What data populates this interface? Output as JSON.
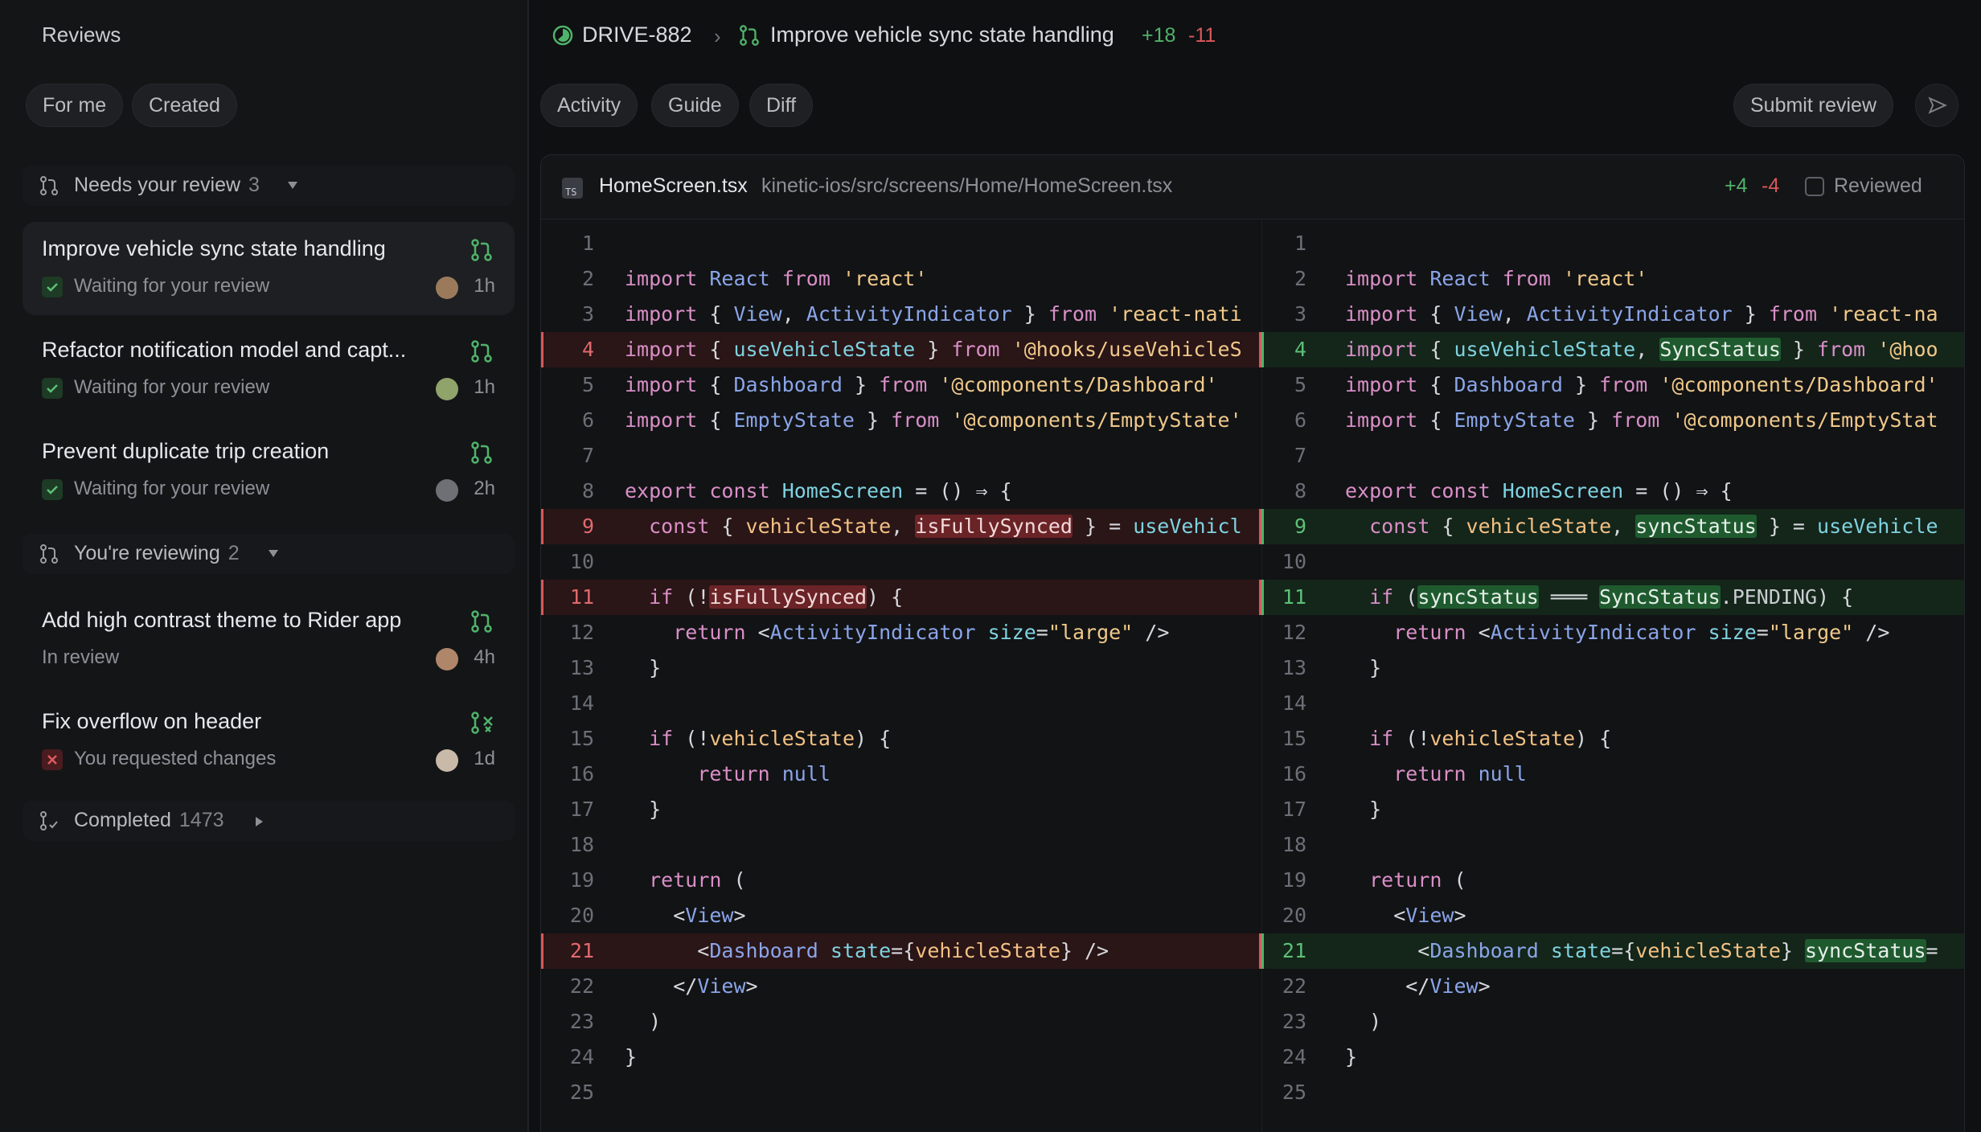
{
  "sidebar": {
    "title": "Reviews",
    "filters": [
      "For me",
      "Created"
    ],
    "sections": [
      {
        "label": "Needs your review",
        "count": "3"
      },
      {
        "label": "You're reviewing",
        "count": "2"
      },
      {
        "label": "Completed",
        "count": "1473"
      }
    ],
    "items": [
      {
        "title": "Improve vehicle sync state handling",
        "status": "Waiting for your review",
        "time": "1h"
      },
      {
        "title": "Refactor notification model and capt...",
        "status": "Waiting for your review",
        "time": "1h"
      },
      {
        "title": "Prevent duplicate trip creation",
        "status": "Waiting for your review",
        "time": "2h"
      },
      {
        "title": "Add high contrast theme to Rider app",
        "status": "In review",
        "time": "4h"
      },
      {
        "title": "Fix overflow on header",
        "status": "You requested changes",
        "time": "1d"
      }
    ]
  },
  "header": {
    "issue_id": "DRIVE-882",
    "title": "Improve vehicle sync state handling",
    "additions": "+18",
    "deletions": "-11",
    "tabs": [
      "Activity",
      "Guide",
      "Diff"
    ],
    "submit_label": "Submit review"
  },
  "file": {
    "name": "HomeScreen.tsx",
    "path": "kinetic-ios/src/screens/Home/HomeScreen.tsx",
    "additions": "+4",
    "deletions": "-4",
    "reviewed_label": "Reviewed",
    "type_badge": "TS"
  },
  "diff": {
    "line_numbers": [
      "1",
      "2",
      "3",
      "4",
      "5",
      "6",
      "7",
      "8",
      "9",
      "10",
      "11",
      "12",
      "13",
      "14",
      "15",
      "16",
      "17",
      "18",
      "19",
      "20",
      "21",
      "22",
      "23",
      "24",
      "25"
    ],
    "left": [
      "",
      "import React from 'react'",
      "import { View, ActivityIndicator } from 'react-nati",
      "import { useVehicleState } from '@hooks/useVehicleS",
      "import { Dashboard } from '@components/Dashboard'",
      "import { EmptyState } from '@components/EmptyState'",
      "",
      "export const HomeScreen = () ⇒ {",
      "  const { vehicleState, isFullySynced } = useVehicl",
      "",
      "  if (!isFullySynced) {",
      "    return <ActivityIndicator size=\"large\" />",
      "  }",
      "",
      "  if (!vehicleState) {",
      "      return null",
      "  }",
      "",
      "  return (",
      "    <View>",
      "      <Dashboard state={vehicleState} />",
      "    </View>",
      "  )",
      "}",
      ""
    ],
    "right": [
      "",
      "import React from 'react'",
      "import { View, ActivityIndicator } from 'react-na",
      "import { useVehicleState, SyncStatus } from '@hoo",
      "import { Dashboard } from '@components/Dashboard'",
      "import { EmptyState } from '@components/EmptyStat",
      "",
      "export const HomeScreen = () ⇒ {",
      "  const { vehicleState, syncStatus } = useVehicle",
      "",
      "  if (syncStatus ═══ SyncStatus.PENDING) {",
      "    return <ActivityIndicator size=\"large\" />",
      "  }",
      "",
      "  if (!vehicleState) {",
      "    return null",
      "  }",
      "",
      "  return (",
      "    <View>",
      "      <Dashboard state={vehicleState} syncStatus=",
      "     </View>",
      "  )",
      "}",
      ""
    ],
    "deleted_lines": [
      4,
      9,
      11,
      21
    ],
    "added_lines": [
      4,
      9,
      11,
      21
    ]
  },
  "colors": {
    "accent_green": "#4fb36a",
    "accent_red": "#d9585b",
    "background": "#0f1012"
  },
  "icons": {
    "section": "pull-request-icon",
    "status": "check-icon",
    "send": "send-icon"
  }
}
